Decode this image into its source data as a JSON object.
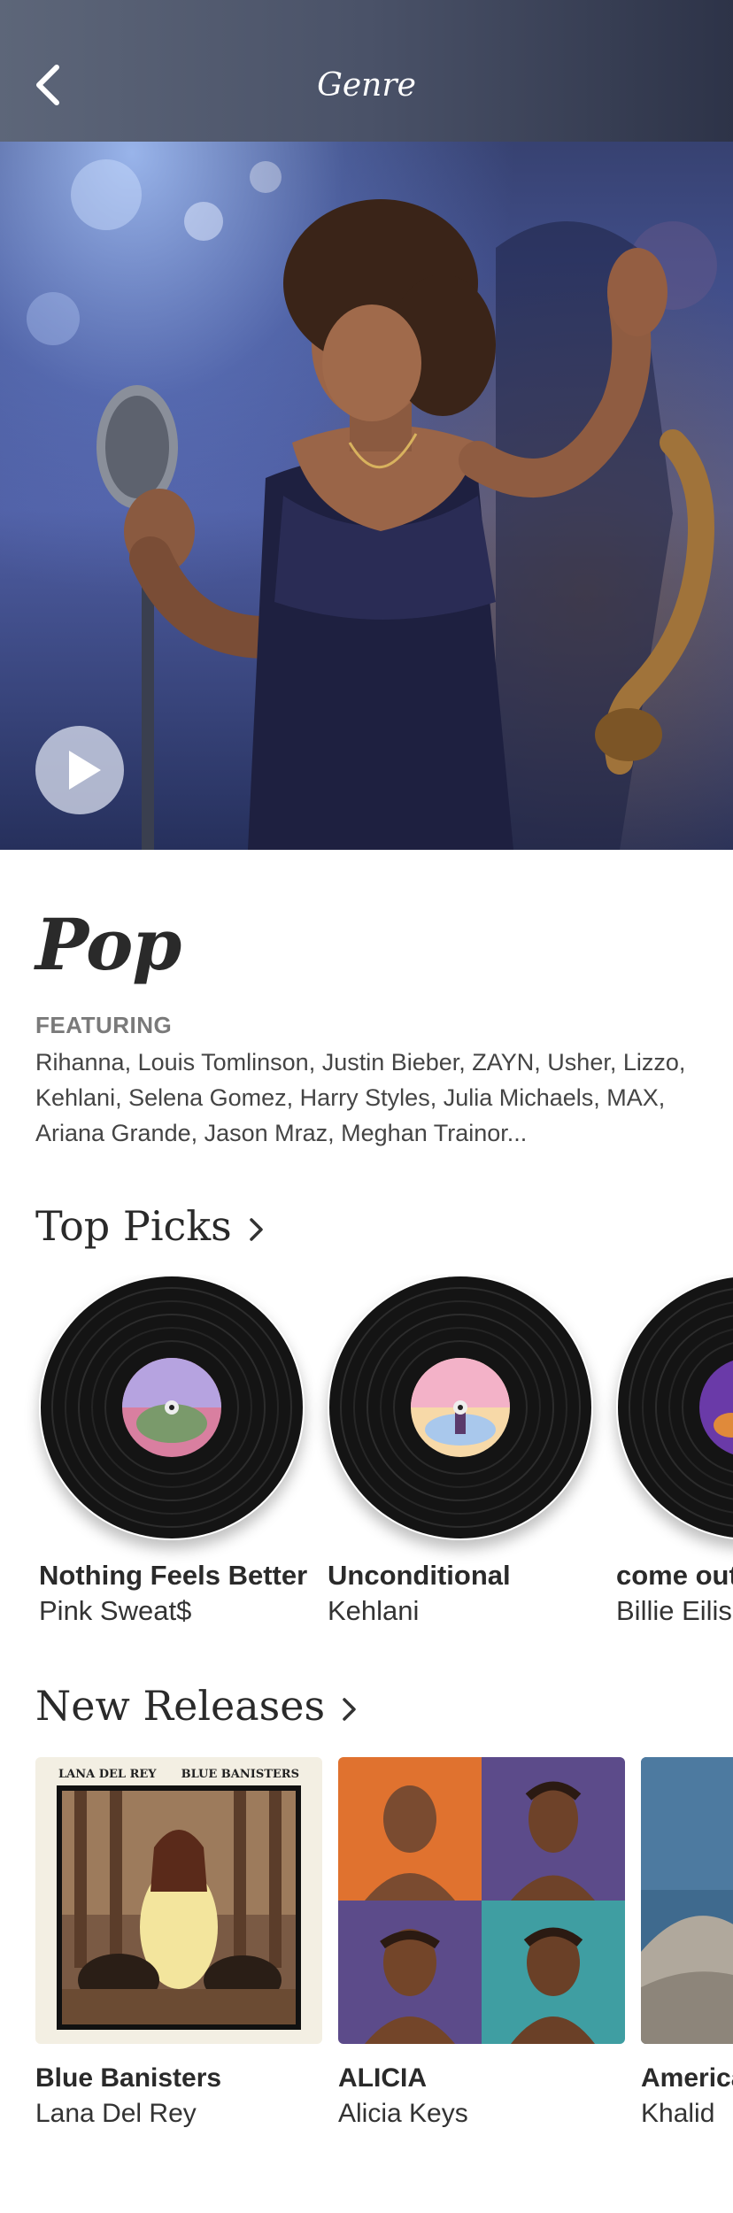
{
  "header": {
    "title": "Genre"
  },
  "genre": {
    "name": "Pop",
    "featuring_label": "FEATURING",
    "featuring_text": "Rihanna, Louis Tomlinson, Justin Bieber, ZAYN, Usher, Lizzo, Kehlani, Selena Gomez, Harry Styles, Julia Michaels, MAX, Ariana Grande, Jason Mraz, Meghan Trainor..."
  },
  "top_picks": {
    "label": "Top Picks",
    "items": [
      {
        "title": "Nothing Feels Better",
        "artist": "Pink Sweat$"
      },
      {
        "title": "Unconditional",
        "artist": "Kehlani"
      },
      {
        "title": "come out and play",
        "artist": "Billie Eilish"
      }
    ]
  },
  "new_releases": {
    "label": "New Releases",
    "items": [
      {
        "title": "Blue Banisters",
        "artist": "Lana Del Rey",
        "cover_text_left": "LANA DEL REY",
        "cover_text_right": "BLUE BANISTERS"
      },
      {
        "title": "ALICIA",
        "artist": "Alicia Keys"
      },
      {
        "title": "American Teen",
        "artist": "Khalid"
      }
    ]
  },
  "colors": {
    "accent_text": "#2a2a2a",
    "muted": "#7a7a7a"
  }
}
